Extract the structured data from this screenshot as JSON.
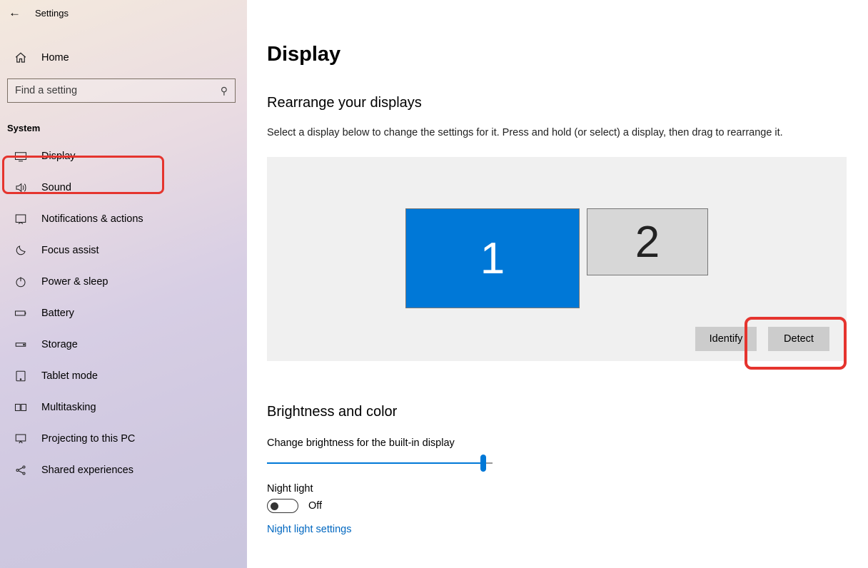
{
  "app_title": "Settings",
  "sidebar": {
    "home": "Home",
    "search_placeholder": "Find a setting",
    "category": "System",
    "items": [
      {
        "label": "Display"
      },
      {
        "label": "Sound"
      },
      {
        "label": "Notifications & actions"
      },
      {
        "label": "Focus assist"
      },
      {
        "label": "Power & sleep"
      },
      {
        "label": "Battery"
      },
      {
        "label": "Storage"
      },
      {
        "label": "Tablet mode"
      },
      {
        "label": "Multitasking"
      },
      {
        "label": "Projecting to this PC"
      },
      {
        "label": "Shared experiences"
      }
    ]
  },
  "main": {
    "title": "Display",
    "section1": {
      "heading": "Rearrange your displays",
      "desc": "Select a display below to change the settings for it. Press and hold (or select) a display, then drag to rearrange it.",
      "monitors": [
        {
          "id": "1",
          "primary": true
        },
        {
          "id": "2",
          "primary": false
        }
      ],
      "identify_btn": "Identify",
      "detect_btn": "Detect"
    },
    "section2": {
      "heading": "Brightness and color",
      "brightness_label": "Change brightness for the built-in display",
      "brightness_pct": 96,
      "nightlight_label": "Night light",
      "nightlight_state": "Off",
      "nightlight_link": "Night light settings"
    }
  }
}
